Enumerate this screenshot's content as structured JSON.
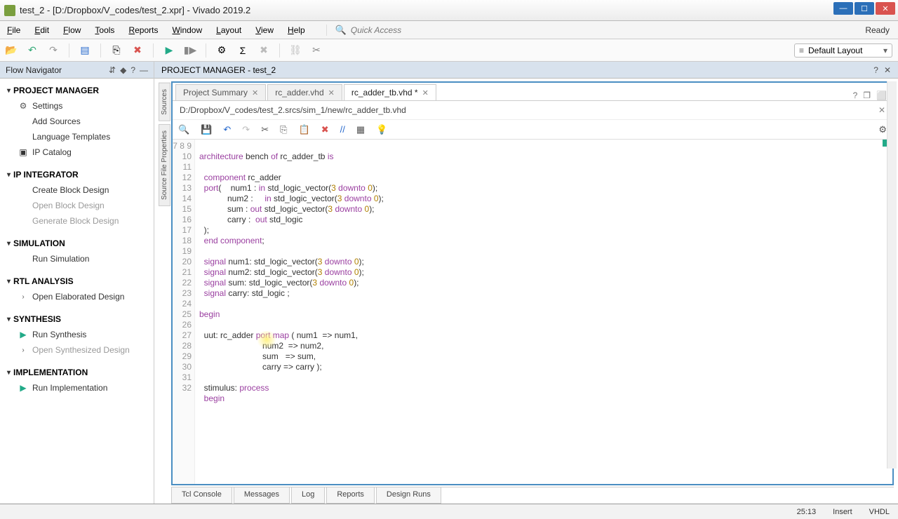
{
  "title": "test_2 - [D:/Dropbox/V_codes/test_2.xpr] - Vivado 2019.2",
  "menus": [
    "File",
    "Edit",
    "Flow",
    "Tools",
    "Reports",
    "Window",
    "Layout",
    "View",
    "Help"
  ],
  "quick_access": "Quick Access",
  "ready": "Ready",
  "layout_select": "Default Layout",
  "flow_nav_title": "Flow Navigator",
  "nav": {
    "pm": "PROJECT MANAGER",
    "pm_items": [
      "Settings",
      "Add Sources",
      "Language Templates",
      "IP Catalog"
    ],
    "ip": "IP INTEGRATOR",
    "ip_items": [
      "Create Block Design",
      "Open Block Design",
      "Generate Block Design"
    ],
    "sim": "SIMULATION",
    "sim_items": [
      "Run Simulation"
    ],
    "rtl": "RTL ANALYSIS",
    "rtl_items": [
      "Open Elaborated Design"
    ],
    "syn": "SYNTHESIS",
    "syn_items": [
      "Run Synthesis",
      "Open Synthesized Design"
    ],
    "impl": "IMPLEMENTATION",
    "impl_items": [
      "Run Implementation"
    ]
  },
  "pm_header": "PROJECT MANAGER - test_2",
  "side_tabs": [
    "Sources",
    "Source File Properties"
  ],
  "tabs": [
    {
      "label": "Project Summary",
      "active": false
    },
    {
      "label": "rc_adder.vhd",
      "active": false
    },
    {
      "label": "rc_adder_tb.vhd *",
      "active": true
    }
  ],
  "filepath": "D:/Dropbox/V_codes/test_2.srcs/sim_1/new/rc_adder_tb.vhd",
  "gutter_start": 7,
  "gutter_end": 32,
  "bottom_tabs": [
    "Tcl Console",
    "Messages",
    "Log",
    "Reports",
    "Design Runs"
  ],
  "status": {
    "pos": "25:13",
    "ins": "Insert",
    "lang": "VHDL"
  }
}
